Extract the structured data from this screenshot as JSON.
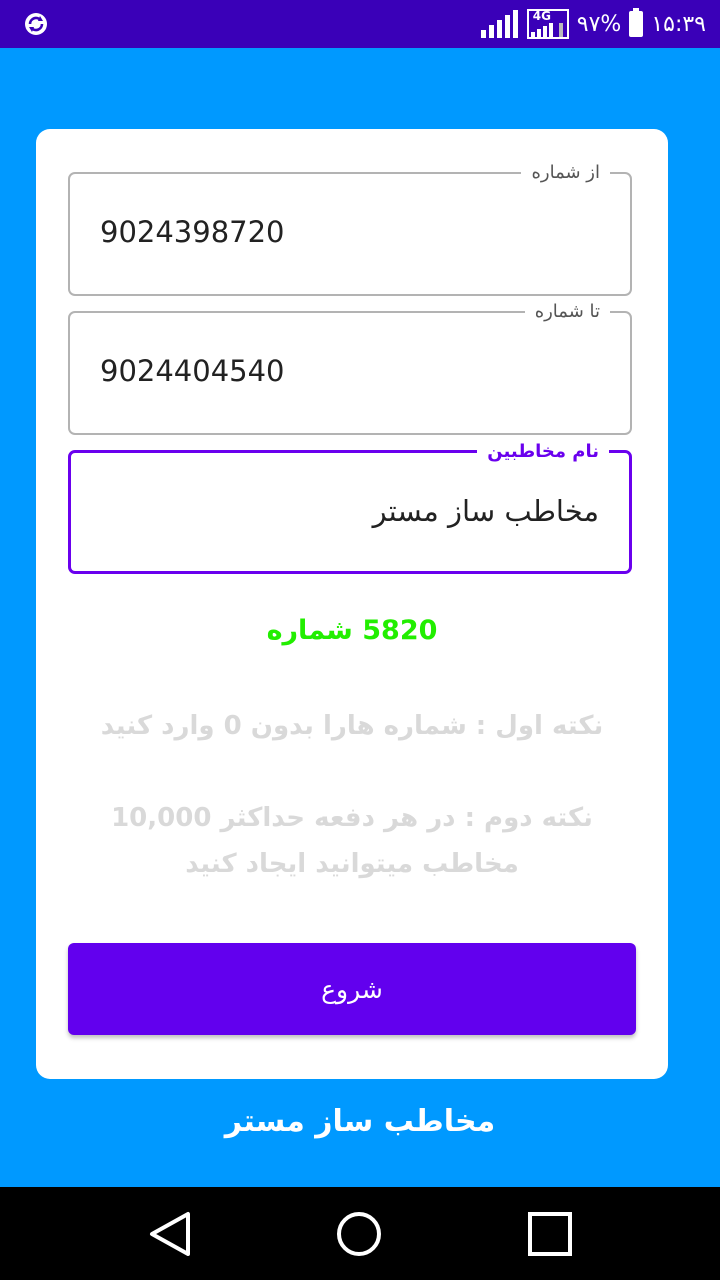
{
  "status_bar": {
    "time": "۱۵:۳۹",
    "battery_percent": "۹۷%",
    "network": "4G",
    "sync_icon": "sync-icon",
    "signal_icon": "signal-icon",
    "battery_icon": "battery-icon"
  },
  "form": {
    "from_number": {
      "label": "از شماره",
      "value": "9024398720"
    },
    "to_number": {
      "label": "تا شماره",
      "value": "9024404540"
    },
    "contact_name": {
      "label": "نام مخاطبین",
      "value": "مخاطب ساز مستر"
    }
  },
  "count_text": "5820 شماره",
  "notes": {
    "first": "نکته اول : شماره هارا بدون 0 وارد کنید",
    "second": "نکته دوم : در هر دفعه حداکثر 10,000 مخاطب میتوانید ایجاد کنید"
  },
  "start_button": "شروع",
  "footer_title": "مخاطب ساز مستر",
  "colors": {
    "status_bar": "#3a00b8",
    "background": "#0099ff",
    "accent": "#6200ee",
    "count": "#22ee00",
    "note_text": "#d9d9d9"
  }
}
